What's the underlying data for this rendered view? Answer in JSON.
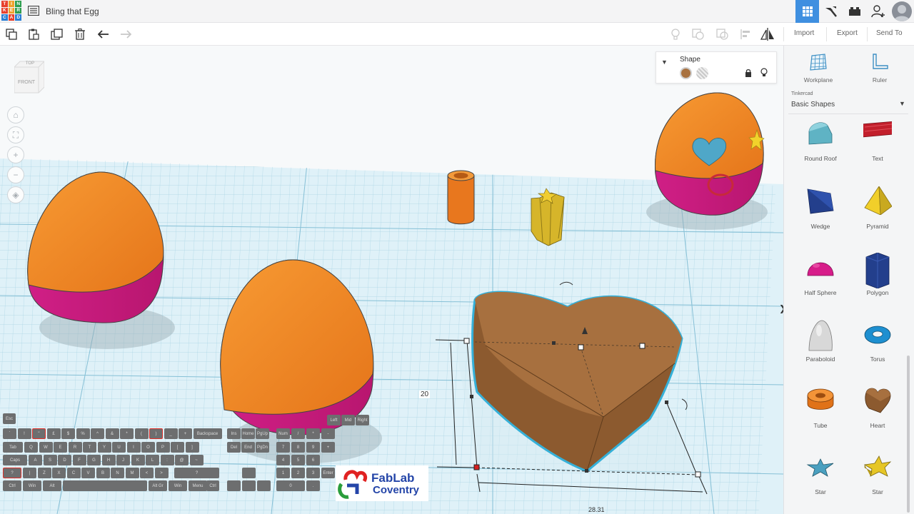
{
  "app": {
    "title": "Bling that Egg",
    "logo_letters": [
      "T",
      "I",
      "N",
      "K",
      "E",
      "R",
      "C",
      "A",
      "D"
    ],
    "logo_colors": [
      "#e8412c",
      "#f0a12b",
      "#2e9e4f",
      "#e8412c",
      "#f0a12b",
      "#2e9e4f",
      "#2a7fd4",
      "#e8412c",
      "#2a7fd4"
    ],
    "accent": "#3f8fe0"
  },
  "toolbar": {
    "import_label": "Import",
    "export_label": "Export",
    "sendto_label": "Send To"
  },
  "viewcube": {
    "top_label": "TOP",
    "front_label": "FRONT"
  },
  "shape_panel": {
    "title": "Shape",
    "solid_color": "#a8713f"
  },
  "dimensions": {
    "height_value": "20",
    "width_value": "28.31"
  },
  "sidebar": {
    "tools": [
      {
        "label": "Workplane",
        "icon": "workplane-icon"
      },
      {
        "label": "Ruler",
        "icon": "ruler-icon"
      }
    ],
    "library": {
      "source": "Tinkercad",
      "name": "Basic Shapes"
    },
    "shapes": [
      {
        "label": "Round Roof"
      },
      {
        "label": "Text"
      },
      {
        "label": "Wedge"
      },
      {
        "label": "Pyramid"
      },
      {
        "label": "Half Sphere"
      },
      {
        "label": "Polygon"
      },
      {
        "label": "Paraboloid"
      },
      {
        "label": "Torus"
      },
      {
        "label": "Tube"
      },
      {
        "label": "Heart"
      },
      {
        "label": "Star"
      },
      {
        "label": "Star"
      }
    ]
  },
  "keyboard": {
    "rows": [
      [
        "Esc"
      ],
      [
        "`",
        "!",
        "\"",
        "£",
        "$",
        "%",
        "^",
        "&",
        "*",
        "(",
        ")",
        "_",
        "+",
        "Backspace"
      ],
      [
        "Tab",
        "Q",
        "W",
        "E",
        "R",
        "T",
        "Y",
        "U",
        "I",
        "O",
        "P",
        "[",
        "]"
      ],
      [
        "Caps",
        "A",
        "S",
        "D",
        "F",
        "G",
        "H",
        "J",
        "K",
        "L",
        ":",
        "@",
        "~"
      ],
      [
        "?",
        "|",
        "Z",
        "X",
        "C",
        "V",
        "B",
        "N",
        "M",
        "<",
        ">",
        "?"
      ],
      [
        "Ctrl",
        "Win",
        "Alt",
        "",
        "Alt Gr",
        "Win",
        "Menu",
        "Ctrl"
      ]
    ],
    "nav_keys": [
      "Ins",
      "Home",
      "PgUp",
      "Del",
      "End",
      "PgDn"
    ],
    "mouse_keys": [
      "Left",
      "Mid",
      "Right"
    ],
    "numpad_keys": [
      "Num",
      "/",
      "*",
      "-",
      "7",
      "8",
      "9",
      "+",
      "4",
      "5",
      "6",
      "1",
      "2",
      "3",
      "Enter",
      "0",
      "."
    ]
  },
  "watermark": {
    "name": "FabLab",
    "city": "Coventry"
  }
}
